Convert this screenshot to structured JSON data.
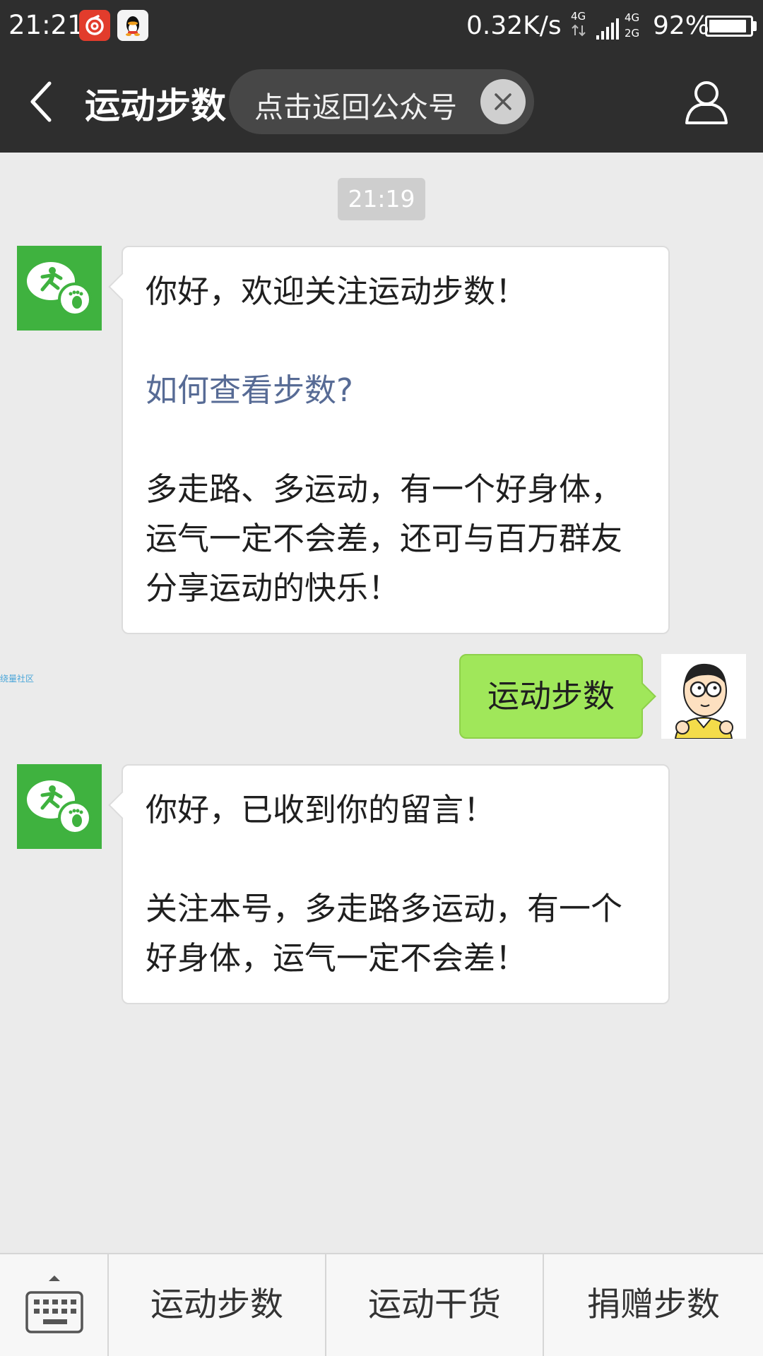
{
  "status_bar": {
    "time": "21:21",
    "net_speed": "0.32K/s",
    "network_top": "4G",
    "network_bottom": "2G",
    "network_left": "4G",
    "battery_percent": "92%",
    "battery_level": 0.92,
    "notification_icons": [
      "netease-music-icon",
      "qq-icon"
    ]
  },
  "title_bar": {
    "title": "运动步数",
    "return_pill_label": "点击返回公众号",
    "icons": {
      "back": "back-arrow-icon",
      "close": "close-icon",
      "profile": "person-icon"
    }
  },
  "chat": {
    "timestamp": "21:19",
    "messages": [
      {
        "from": "official-account",
        "lines": [
          "你好，欢迎关注运动步数！",
          "",
          "如何查看步数?",
          "",
          "多走路、多运动，有一个好身体，",
          "运气一定不会差，还可与百万群友",
          "分享运动的快乐！"
        ]
      },
      {
        "from": "me",
        "text": "运动步数"
      },
      {
        "from": "official-account",
        "lines": [
          "你好，已收到你的留言！",
          "",
          "关注本号，多走路多运动，有一个",
          "好身体，运气一定不会差！"
        ]
      }
    ],
    "watermark": "绕量社区"
  },
  "colors": {
    "header_bg": "#2e2e2e",
    "chat_bg": "#ebebeb",
    "bot_avatar_green": "#3fb23f",
    "outgoing_bubble": "#a0e75a",
    "link_blue": "#576b95"
  },
  "menu": {
    "keyboard_toggle_icon": "keyboard-icon",
    "items": [
      "运动步数",
      "运动干货",
      "捐赠步数"
    ]
  }
}
